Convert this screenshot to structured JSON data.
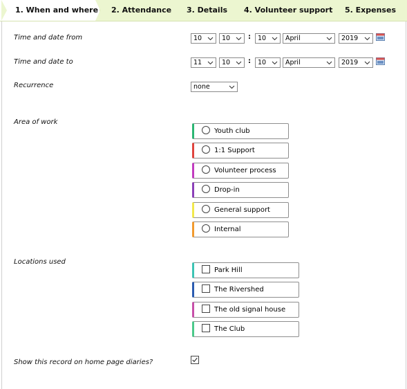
{
  "tabs": [
    {
      "label": "1. When and where",
      "active": true
    },
    {
      "label": "2. Attendance"
    },
    {
      "label": "3. Details"
    },
    {
      "label": "4. Volunteer support"
    },
    {
      "label": "5. Expenses"
    }
  ],
  "form": {
    "time_from": {
      "label": "Time and date from",
      "hour": "10",
      "minute": "10",
      "second": "10",
      "month": "April",
      "year": "2019",
      "separator": ":"
    },
    "time_to": {
      "label": "Time and date to",
      "hour": "11",
      "minute": "10",
      "second": "10",
      "month": "April",
      "year": "2019",
      "separator": ":"
    },
    "recurrence": {
      "label": "Recurrence",
      "value": "none"
    },
    "area_of_work": {
      "label": "Area of work",
      "options": [
        {
          "label": "Youth club",
          "color": "#2bb673"
        },
        {
          "label": "1:1 Support",
          "color": "#e0443e"
        },
        {
          "label": "Volunteer process",
          "color": "#c23bbf"
        },
        {
          "label": "Drop-in",
          "color": "#8b3fb8"
        },
        {
          "label": "General support",
          "color": "#f2e84b"
        },
        {
          "label": "Internal",
          "color": "#f29a2e"
        }
      ]
    },
    "locations_used": {
      "label": "Locations used",
      "options": [
        {
          "label": "Park Hill",
          "color": "#3cc4b4"
        },
        {
          "label": "The Rivershed",
          "color": "#2a5bb0"
        },
        {
          "label": "The old signal house",
          "color": "#c74fa8"
        },
        {
          "label": "The Club",
          "color": "#4bc98a"
        }
      ]
    },
    "show_on_home": {
      "label": "Show this record on home page diaries?",
      "checked": true
    }
  },
  "icons": {
    "select_arrow": "chevron-down-icon",
    "calendar": "calendar-icon",
    "checkmark": "checkmark-icon"
  }
}
